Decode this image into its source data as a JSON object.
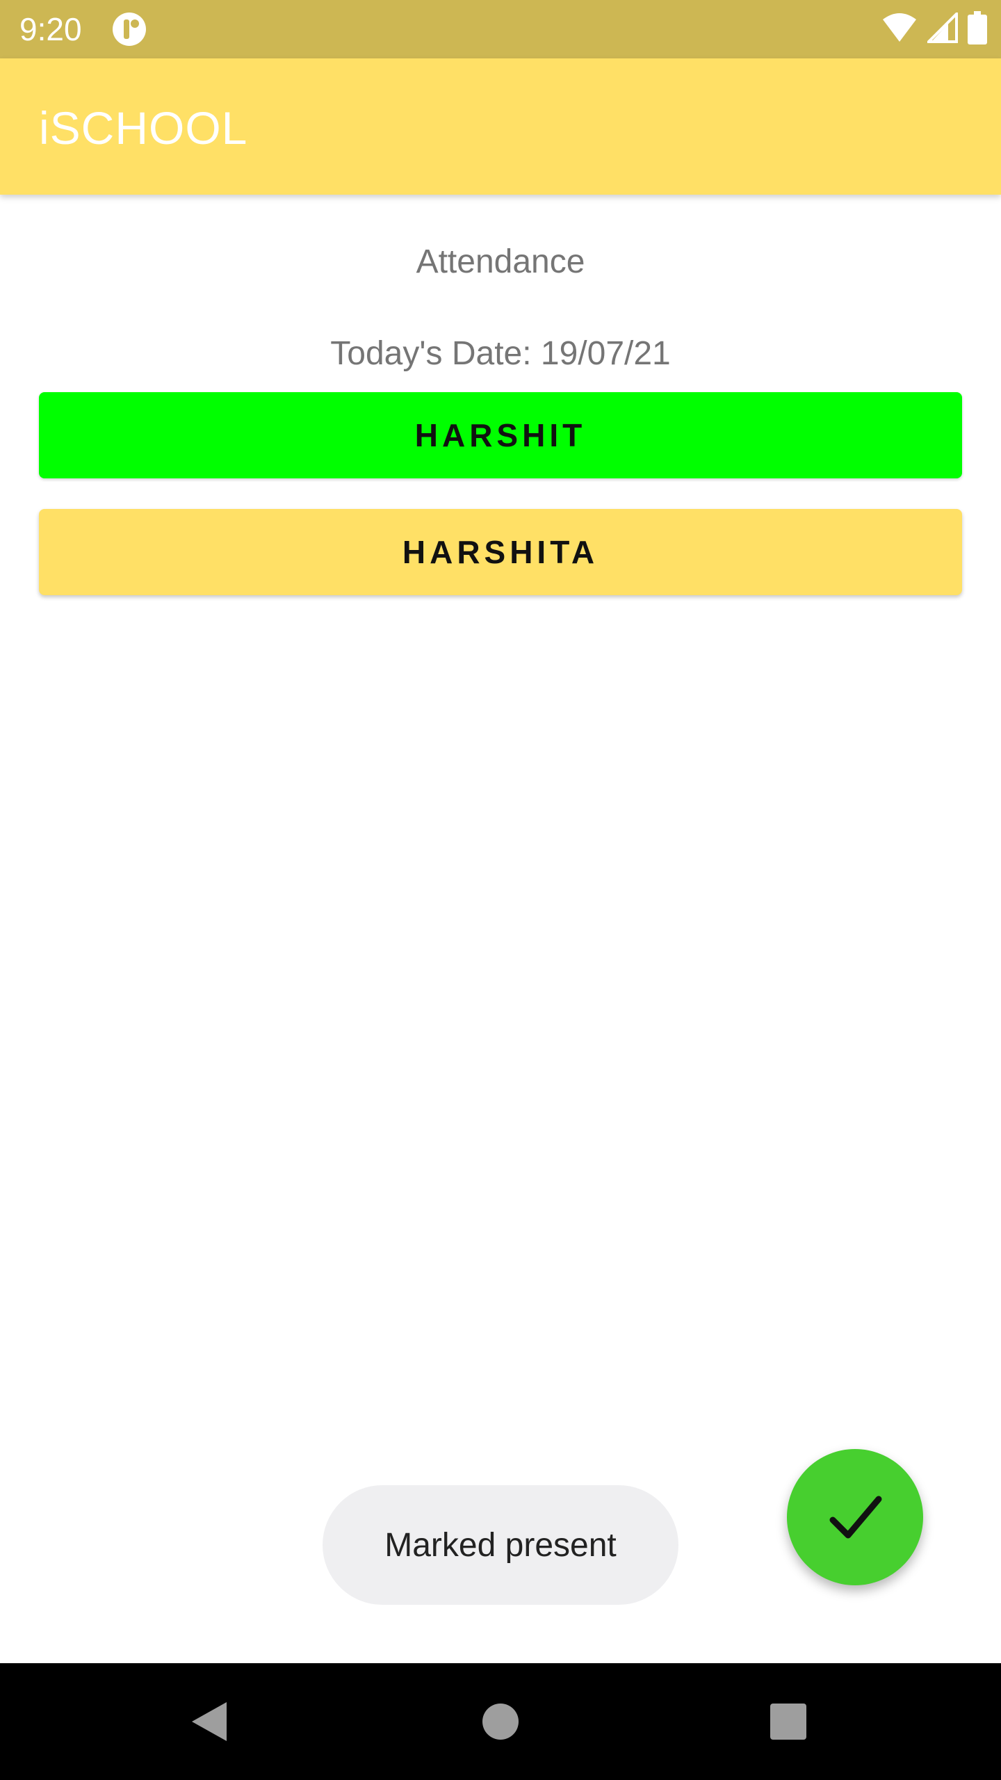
{
  "status_bar": {
    "time": "9:20",
    "left_icon": "app-notification-icon",
    "right_icons": [
      "wifi-icon",
      "cellular-signal-icon",
      "battery-icon"
    ]
  },
  "app_bar": {
    "title": "iSCHOOL"
  },
  "content": {
    "heading": "Attendance",
    "date_line": "Today's Date: 19/07/21",
    "students": [
      {
        "name": "HARSHIT",
        "color": "#00FF00",
        "status": "present"
      },
      {
        "name": "HARSHITA",
        "color": "#FFE066"
      }
    ]
  },
  "toast": {
    "message": "Marked present"
  },
  "fab": {
    "icon": "check-icon",
    "color": "#47CF2F"
  },
  "nav_bar": {
    "icons": [
      "back-icon",
      "home-icon",
      "recents-icon"
    ]
  },
  "colors": {
    "status_bar": "#CDB753",
    "app_bar": "#FFE066",
    "present": "#00FF00",
    "fab": "#47CF2F"
  }
}
